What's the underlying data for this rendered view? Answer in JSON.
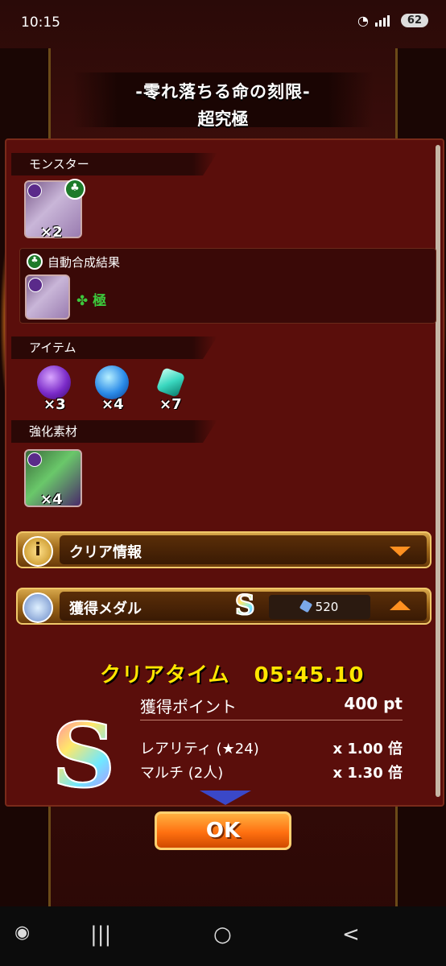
{
  "status": {
    "time": "10:15",
    "battery": "62"
  },
  "title": {
    "line1": "-零れ落ちる命の刻限-",
    "line2": "超究極"
  },
  "sections": {
    "monster": {
      "label": "モンスター",
      "count": "×2"
    },
    "auto": {
      "label": "自動合成結果",
      "result": "極"
    },
    "items": {
      "label": "アイテム",
      "counts": [
        "×3",
        "×4",
        "×7"
      ]
    },
    "material": {
      "label": "強化素材",
      "count": "×4"
    }
  },
  "bars": {
    "clear_info": {
      "label": "クリア情報"
    },
    "medal": {
      "label": "獲得メダル",
      "rank": "S",
      "value": "520"
    }
  },
  "result": {
    "clear_time_label": "クリアタイム",
    "clear_time": "05:45.10",
    "points_label": "獲得ポイント",
    "points_value": "400 pt",
    "rarity_label": "レアリティ (★24)",
    "rarity_value": "x 1.00 倍",
    "multi_label": "マルチ (2人)",
    "multi_value": "x 1.30 倍",
    "rank": "S"
  },
  "ok_button": "OK",
  "nav": {
    "recent": "|||",
    "home": "○",
    "back": "<"
  }
}
